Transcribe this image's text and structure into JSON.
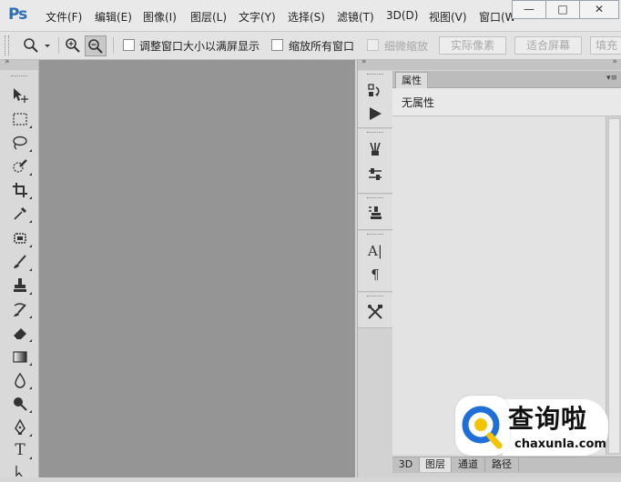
{
  "app": {
    "logo": "Ps"
  },
  "menu": [
    "文件(F)",
    "编辑(E)",
    "图像(I)",
    "图层(L)",
    "文字(Y)",
    "选择(S)",
    "滤镜(T)",
    "3D(D)",
    "视图(V)",
    "窗口(W"
  ],
  "window_buttons": {
    "minimize": "—",
    "maximize": "□",
    "close": "✕"
  },
  "options": {
    "resize_windows_label": "调整窗口大小以满屏显示",
    "zoom_all_label": "缩放所有窗口",
    "scrubby_zoom_label": "细微缩放",
    "actual_pixels": "实际像素",
    "fit_screen": "适合屏幕",
    "fill_screen": "填充"
  },
  "toolbox": {
    "collapse": "»",
    "text_tool_glyph": "T"
  },
  "dock": {
    "collapse": "»",
    "char_glyph": "A|",
    "para_glyph": "¶"
  },
  "panel": {
    "collapse": "»",
    "tab": "属性",
    "menu_glyph": "▾≡",
    "content": "无属性",
    "bottom_tabs": [
      "3D",
      "图层",
      "通道",
      "路径"
    ]
  },
  "watermark": {
    "main": "查询啦",
    "sub": "chaxunla.com"
  },
  "colors": {
    "accent": "#2b6fb6",
    "canvas": "#959595",
    "watermark_blue": "#1e6fd9",
    "watermark_yellow": "#f5c400"
  }
}
